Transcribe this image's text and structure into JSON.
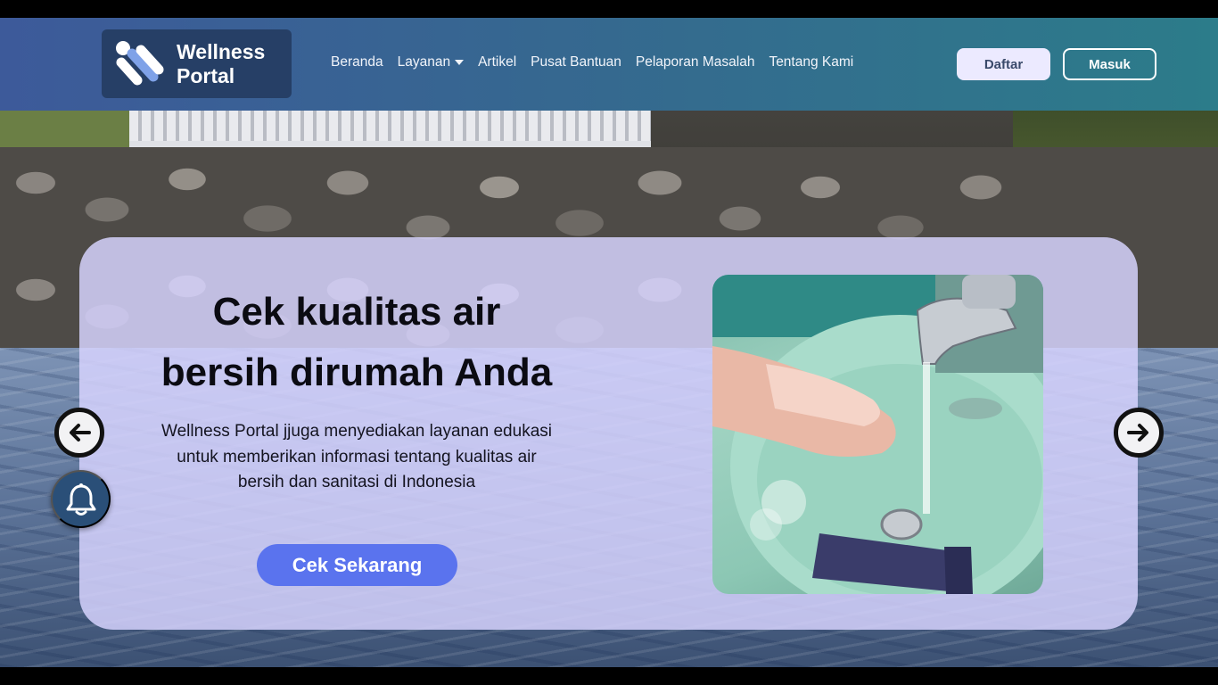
{
  "brand": {
    "name_line1": "Wellness",
    "name_line2": "Portal"
  },
  "nav": {
    "items": [
      {
        "label": "Beranda"
      },
      {
        "label": "Layanan",
        "has_dropdown": true
      },
      {
        "label": "Artikel"
      },
      {
        "label": "Pusat Bantuan"
      },
      {
        "label": "Pelaporan Masalah"
      },
      {
        "label": "Tentang Kami"
      }
    ]
  },
  "auth": {
    "register_label": "Daftar",
    "login_label": "Masuk"
  },
  "hero": {
    "title_line1": "Cek kualitas air",
    "title_line2": "bersih dirumah Anda",
    "description_line1": "Wellness Portal jjuga menyediakan layanan edukasi",
    "description_line2": "untuk memberikan informasi tentang kualitas air",
    "description_line3": "bersih dan sanitasi di Indonesia",
    "cta_label": "Cek Sekarang"
  },
  "icons": {
    "prev": "arrow-left-icon",
    "next": "arrow-right-icon",
    "notification": "bell-icon",
    "dropdown": "caret-down-icon"
  },
  "colors": {
    "navbar_start": "#3d5a9a",
    "navbar_end": "#2c7c8a",
    "logo_bg": "#263f66",
    "card_bg": "#d8d4ff",
    "cta": "#5a73ee",
    "register_bg": "#eceaff",
    "bell_bg": "#2a4f78"
  }
}
